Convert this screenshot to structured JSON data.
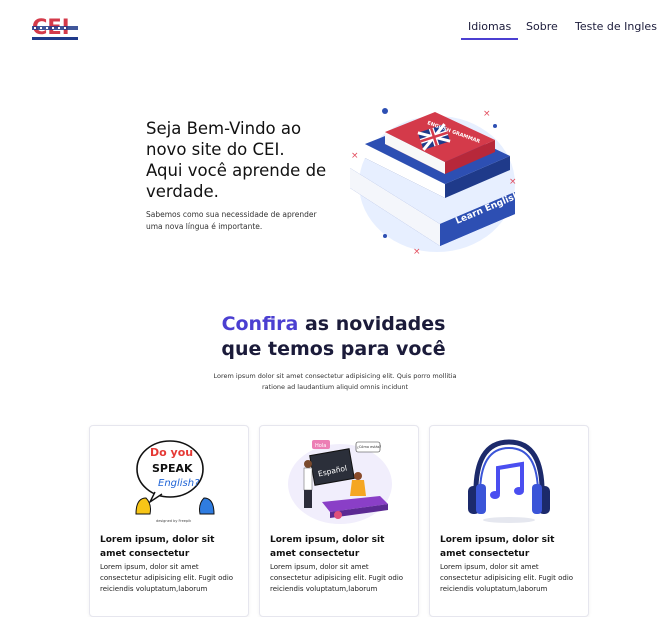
{
  "brand": {
    "logo_text": "CEI"
  },
  "nav": {
    "items": [
      {
        "label": "Idiomas"
      },
      {
        "label": "Sobre"
      },
      {
        "label": "Teste de Ingles"
      }
    ]
  },
  "hero": {
    "title_lines": [
      "Seja Bem-Vindo ao",
      "novo site do CEI.",
      "Aqui você aprende de",
      "verdade."
    ],
    "subtitle": "Sabemos como sua necessidade de aprender uma nova língua é importante.",
    "book_top_label": "ENGLISH GRAMMAR",
    "book_spine_label": "Learn English"
  },
  "section": {
    "title_accent": "Confira",
    "title_rest": " as novidades",
    "title_line2": "que temos para você",
    "subtitle": "Lorem ipsum dolor sit amet consectetur adipisicing elit. Quis porro mollitia ratione ad laudantium aliquid omnis incidunt"
  },
  "cards": [
    {
      "title": "Lorem ipsum, dolor sit amet consectetur",
      "text": "Lorem ipsum, dolor sit amet consectetur adipisicing elit. Fugit odio reiciendis voluptatum,laborum",
      "bubble_1": "Do you",
      "bubble_2": "SPEAK",
      "bubble_3": "English?",
      "credit": "designed by Freepik"
    },
    {
      "title": "Lorem ipsum, dolor sit amet consectetur",
      "text": "Lorem ipsum, dolor sit amet consectetur adipisicing elit. Fugit odio reiciendis voluptatum,laborum",
      "board_text": "Español",
      "bubble_1": "Hola",
      "bubble_2": "¿Cómo estás?"
    },
    {
      "title": "Lorem ipsum, dolor sit amet consectetur",
      "text": "Lorem ipsum, dolor sit amet consectetur adipisicing elit. Fugit odio reiciendis voluptatum,laborum"
    }
  ],
  "colors": {
    "accent": "#4b3fd1",
    "dark": "#1b1b3a",
    "book_red": "#d43a4a",
    "book_blue": "#2d4fb3"
  }
}
